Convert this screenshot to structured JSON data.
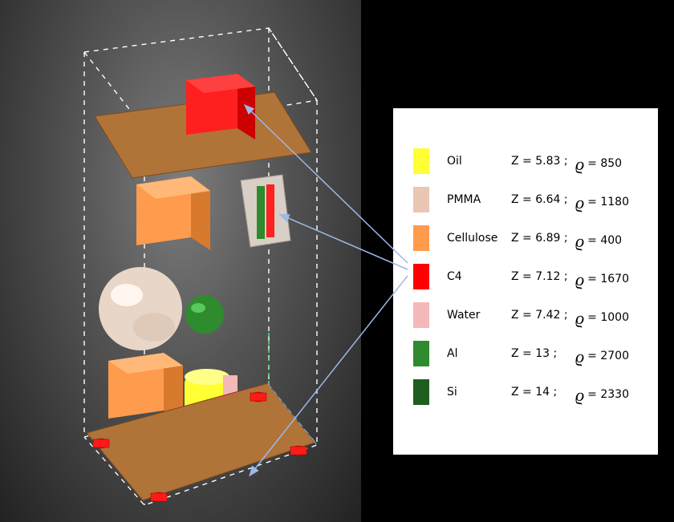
{
  "legend": {
    "rho_symbol": "ϱ",
    "items": [
      {
        "name": "Oil",
        "z_label": "Z = 5.83 ;",
        "rho": "= 850",
        "color": "#ffff33"
      },
      {
        "name": "PMMA",
        "z_label": "Z = 6.64 ;",
        "rho": "= 1180",
        "color": "#e9c7b3"
      },
      {
        "name": "Cellulose",
        "z_label": "Z = 6.89 ;",
        "rho": "= 400",
        "color": "#ff9b4d"
      },
      {
        "name": "C4",
        "z_label": "Z = 7.12 ;",
        "rho": "= 1670",
        "color": "#ff0000"
      },
      {
        "name": "Water",
        "z_label": "Z = 7.42 ;",
        "rho": "= 1000",
        "color": "#f5b8b8"
      },
      {
        "name": "Al",
        "z_label": "Z = 13 ;",
        "rho": "= 2700",
        "color": "#2e8b2e"
      },
      {
        "name": "Si",
        "z_label": "Z = 14 ;",
        "rho": "= 2330",
        "color": "#1e5e1e"
      }
    ]
  },
  "scene": {
    "objects": [
      {
        "kind": "red-cube-top",
        "material": "C4"
      },
      {
        "kind": "cellulose-cube",
        "material": "Cellulose"
      },
      {
        "kind": "pmma-sphere",
        "material": "PMMA"
      },
      {
        "kind": "al-sphere",
        "material": "Al"
      },
      {
        "kind": "cellulose-cube-low",
        "material": "Cellulose"
      },
      {
        "kind": "oil-cylinder",
        "material": "Oil"
      },
      {
        "kind": "water-wrap",
        "material": "Water"
      },
      {
        "kind": "detector-tray",
        "material": "Cellulose/board"
      },
      {
        "kind": "red-feet",
        "material": "C4"
      }
    ]
  }
}
